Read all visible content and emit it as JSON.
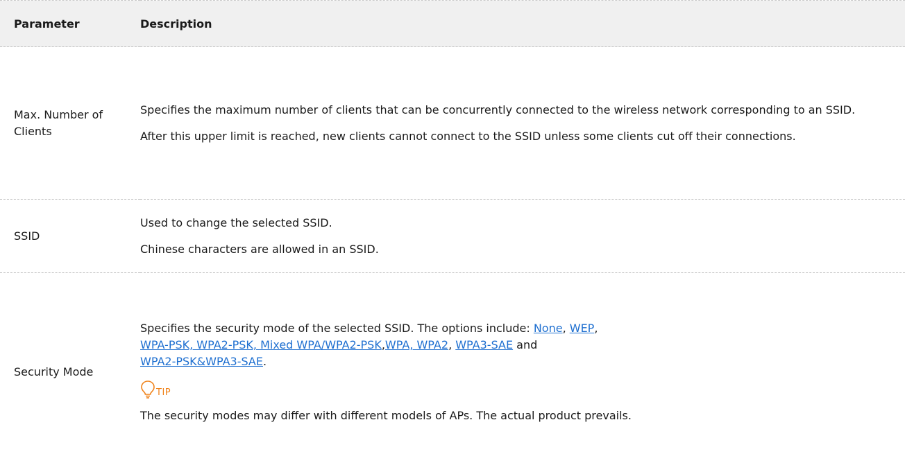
{
  "table": {
    "header": {
      "parameter": "Parameter",
      "description": "Description"
    },
    "rows": [
      {
        "parameter": "Max. Number of Clients",
        "paragraphs": [
          "Specifies the maximum number of clients that can be concurrently connected to the wireless network corresponding to an SSID.",
          "After this upper limit is reached, new clients cannot connect to the SSID unless some clients cut off their connections."
        ]
      },
      {
        "parameter": "SSID",
        "paragraphs": [
          "Used to change the selected SSID.",
          "Chinese characters are allowed in an SSID."
        ]
      },
      {
        "parameter": "Security Mode",
        "intro": "Specifies the security mode of the selected SSID. The options include: ",
        "links": {
          "none": "None",
          "sep1": ", ",
          "wep": "WEP",
          "sep2": ", ",
          "wpa_group": "WPA-PSK, WPA2-PSK, Mixed WPA/WPA2-PSK",
          "sep3": ",",
          "wpa_wpa2": "WPA, WPA2",
          "sep4": ", ",
          "wpa3": "WPA3-SAE",
          "sep5": " and ",
          "wpa2_wpa3": "WPA2-PSK&WPA3-SAE",
          "end": "."
        },
        "tip_label": "TIP",
        "tip_text": "The security modes may differ with different models of APs. The actual product prevails.",
        "tip_color": "#f08219",
        "link_color": "#1e6fd0"
      }
    ]
  }
}
